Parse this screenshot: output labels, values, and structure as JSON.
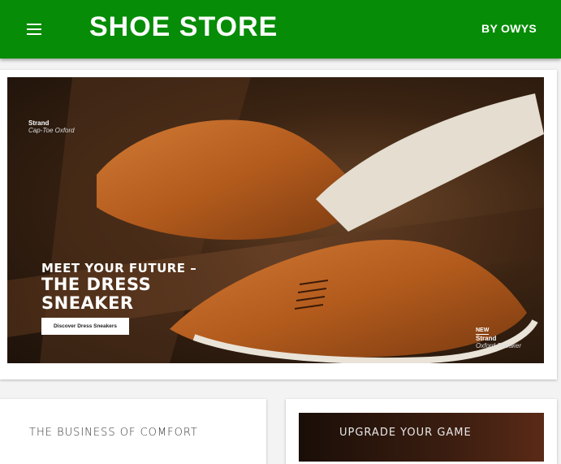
{
  "appbar": {
    "title": "SHOE STORE",
    "byline": "BY OWYS",
    "menu_icon": "menu-icon",
    "color": "#068c06"
  },
  "hero": {
    "headline_line1": "MEET YOUR FUTURE –",
    "headline_line2": "THE DRESS",
    "headline_line3": "SNEAKER",
    "cta": "Discover Dress Sneakers",
    "tag_top_name": "Strand",
    "tag_top_style": "Cap-Toe Oxford",
    "tag_bottom_new": "NEW",
    "tag_bottom_name": "Strand",
    "tag_bottom_style": "Oxford Sneaker"
  },
  "promos": [
    {
      "text": "THE BUSINESS OF COMFORT"
    },
    {
      "text": "UPGRADE YOUR GAME"
    }
  ]
}
